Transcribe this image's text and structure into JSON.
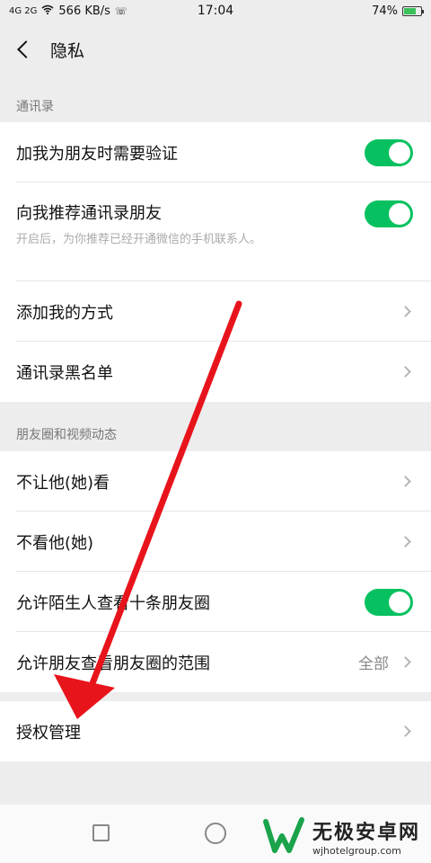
{
  "status_bar": {
    "signal_text": "4G 2G",
    "speed": "566 KB/s",
    "time": "17:04",
    "battery": "74%",
    "battery_level": 0.74
  },
  "header": {
    "title": "隐私"
  },
  "sections": {
    "contacts": {
      "header": "通讯录",
      "verify_label": "加我为朋友时需要验证",
      "verify_on": true,
      "recommend_label": "向我推荐通讯录朋友",
      "recommend_on": true,
      "recommend_hint": "开启后，为你推荐已经开通微信的手机联系人。",
      "add_methods_label": "添加我的方式",
      "blacklist_label": "通讯录黑名单"
    },
    "moments": {
      "header": "朋友圈和视频动态",
      "hide_from_label": "不让他(她)看",
      "dont_see_label": "不看他(她)",
      "strangers_label": "允许陌生人查看十条朋友圈",
      "strangers_on": true,
      "range_label": "允许朋友查看朋友圈的范围",
      "range_value": "全部"
    },
    "auth": {
      "auth_label": "授权管理"
    }
  },
  "watermark": {
    "title": "无极安卓网",
    "url": "wjhotelgroup.com"
  },
  "colors": {
    "toggle_on": "#07c160",
    "annotation_arrow": "#e8141c"
  }
}
